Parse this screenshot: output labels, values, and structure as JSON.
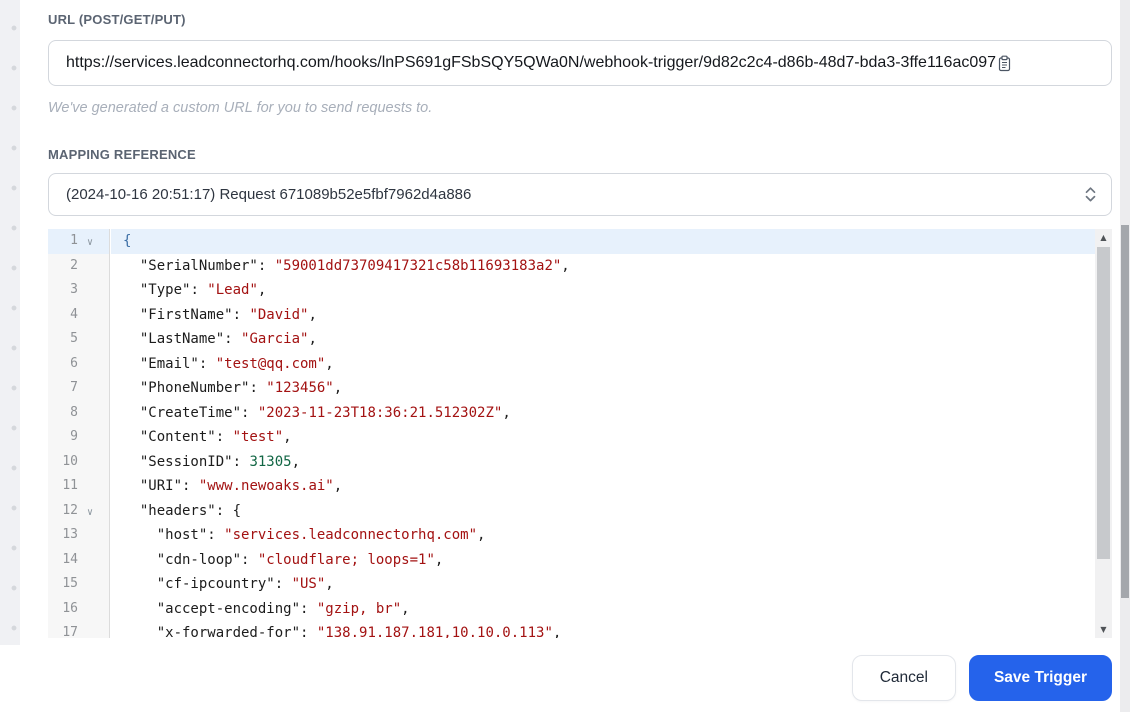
{
  "url_section": {
    "label": "URL (POST/GET/PUT)",
    "value": "https://services.leadconnectorhq.com/hooks/lnPS691gFSbSQY5QWa0N/webhook-trigger/9d82c2c4-d86b-48d7-bda3-3ffe116ac097",
    "helper": "We've generated a custom URL for you to send requests to.",
    "copy_icon": "clipboard-icon"
  },
  "mapping_section": {
    "label": "MAPPING REFERENCE",
    "selected_option": "(2024-10-16 20:51:17) Request 671089b52e5fbf7962d4a886",
    "select_icon": "up-down-chevron-icon"
  },
  "editor": {
    "fold_glyph": "∨",
    "scroll_up_glyph": "▲",
    "scroll_down_glyph": "▼",
    "colors": {
      "string": "#a31212",
      "number": "#116644",
      "active_line_bg": "#e7f1fc"
    },
    "lines": [
      {
        "num": "1",
        "fold": true,
        "active": true,
        "segments": [
          {
            "type": "brace",
            "text": "{"
          }
        ]
      },
      {
        "num": "2",
        "segments": [
          {
            "type": "key",
            "text": "  \"SerialNumber\""
          },
          {
            "type": "punct",
            "text": ": "
          },
          {
            "type": "str",
            "text": "\"59001dd73709417321c58b11693183a2\""
          },
          {
            "type": "punct",
            "text": ","
          }
        ]
      },
      {
        "num": "3",
        "segments": [
          {
            "type": "key",
            "text": "  \"Type\""
          },
          {
            "type": "punct",
            "text": ": "
          },
          {
            "type": "str",
            "text": "\"Lead\""
          },
          {
            "type": "punct",
            "text": ","
          }
        ]
      },
      {
        "num": "4",
        "segments": [
          {
            "type": "key",
            "text": "  \"FirstName\""
          },
          {
            "type": "punct",
            "text": ": "
          },
          {
            "type": "str",
            "text": "\"David\""
          },
          {
            "type": "punct",
            "text": ","
          }
        ]
      },
      {
        "num": "5",
        "segments": [
          {
            "type": "key",
            "text": "  \"LastName\""
          },
          {
            "type": "punct",
            "text": ": "
          },
          {
            "type": "str",
            "text": "\"Garcia\""
          },
          {
            "type": "punct",
            "text": ","
          }
        ]
      },
      {
        "num": "6",
        "segments": [
          {
            "type": "key",
            "text": "  \"Email\""
          },
          {
            "type": "punct",
            "text": ": "
          },
          {
            "type": "str",
            "text": "\"test@qq.com\""
          },
          {
            "type": "punct",
            "text": ","
          }
        ]
      },
      {
        "num": "7",
        "segments": [
          {
            "type": "key",
            "text": "  \"PhoneNumber\""
          },
          {
            "type": "punct",
            "text": ": "
          },
          {
            "type": "str",
            "text": "\"123456\""
          },
          {
            "type": "punct",
            "text": ","
          }
        ]
      },
      {
        "num": "8",
        "segments": [
          {
            "type": "key",
            "text": "  \"CreateTime\""
          },
          {
            "type": "punct",
            "text": ": "
          },
          {
            "type": "str",
            "text": "\"2023-11-23T18:36:21.512302Z\""
          },
          {
            "type": "punct",
            "text": ","
          }
        ]
      },
      {
        "num": "9",
        "segments": [
          {
            "type": "key",
            "text": "  \"Content\""
          },
          {
            "type": "punct",
            "text": ": "
          },
          {
            "type": "str",
            "text": "\"test\""
          },
          {
            "type": "punct",
            "text": ","
          }
        ]
      },
      {
        "num": "10",
        "segments": [
          {
            "type": "key",
            "text": "  \"SessionID\""
          },
          {
            "type": "punct",
            "text": ": "
          },
          {
            "type": "num",
            "text": "31305"
          },
          {
            "type": "punct",
            "text": ","
          }
        ]
      },
      {
        "num": "11",
        "segments": [
          {
            "type": "key",
            "text": "  \"URI\""
          },
          {
            "type": "punct",
            "text": ": "
          },
          {
            "type": "str",
            "text": "\"www.newoaks.ai\""
          },
          {
            "type": "punct",
            "text": ","
          }
        ]
      },
      {
        "num": "12",
        "fold": true,
        "segments": [
          {
            "type": "key",
            "text": "  \"headers\""
          },
          {
            "type": "punct",
            "text": ": {"
          }
        ]
      },
      {
        "num": "13",
        "segments": [
          {
            "type": "key",
            "text": "    \"host\""
          },
          {
            "type": "punct",
            "text": ": "
          },
          {
            "type": "str",
            "text": "\"services.leadconnectorhq.com\""
          },
          {
            "type": "punct",
            "text": ","
          }
        ]
      },
      {
        "num": "14",
        "segments": [
          {
            "type": "key",
            "text": "    \"cdn-loop\""
          },
          {
            "type": "punct",
            "text": ": "
          },
          {
            "type": "str",
            "text": "\"cloudflare; loops=1\""
          },
          {
            "type": "punct",
            "text": ","
          }
        ]
      },
      {
        "num": "15",
        "segments": [
          {
            "type": "key",
            "text": "    \"cf-ipcountry\""
          },
          {
            "type": "punct",
            "text": ": "
          },
          {
            "type": "str",
            "text": "\"US\""
          },
          {
            "type": "punct",
            "text": ","
          }
        ]
      },
      {
        "num": "16",
        "segments": [
          {
            "type": "key",
            "text": "    \"accept-encoding\""
          },
          {
            "type": "punct",
            "text": ": "
          },
          {
            "type": "str",
            "text": "\"gzip, br\""
          },
          {
            "type": "punct",
            "text": ","
          }
        ]
      },
      {
        "num": "17",
        "segments": [
          {
            "type": "key",
            "text": "    \"x-forwarded-for\""
          },
          {
            "type": "punct",
            "text": ": "
          },
          {
            "type": "str",
            "text": "\"138.91.187.181,10.10.0.113\""
          },
          {
            "type": "punct",
            "text": ","
          }
        ]
      }
    ]
  },
  "footer": {
    "cancel_label": "Cancel",
    "save_label": "Save Trigger",
    "save_color": "#2563eb"
  }
}
